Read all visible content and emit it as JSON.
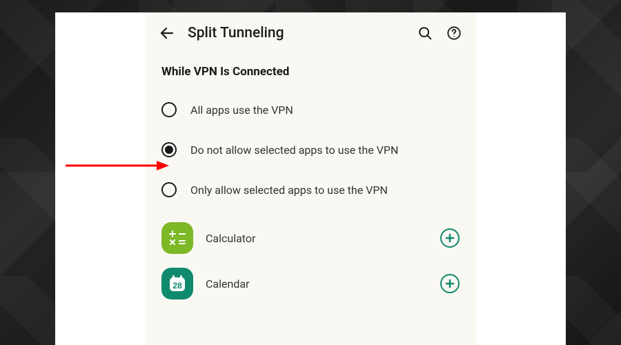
{
  "header": {
    "title": "Split Tunneling"
  },
  "section": {
    "title": "While VPN Is Connected"
  },
  "options": [
    {
      "label": "All apps use the VPN",
      "selected": false
    },
    {
      "label": "Do not allow selected apps to use the VPN",
      "selected": true
    },
    {
      "label": "Only allow selected apps to use the VPN",
      "selected": false
    }
  ],
  "apps": [
    {
      "name": "Calculator",
      "icon": "calculator",
      "badge": ""
    },
    {
      "name": "Calendar",
      "icon": "calendar",
      "badge": "28"
    }
  ]
}
